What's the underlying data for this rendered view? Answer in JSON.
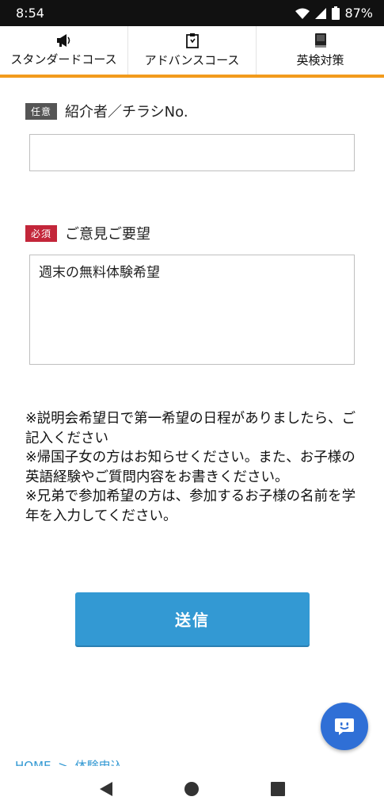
{
  "status_bar": {
    "time": "8:54",
    "battery": "87%"
  },
  "nav": {
    "items": [
      {
        "label": "スタンダードコース",
        "icon": "megaphone-icon"
      },
      {
        "label": "アドバンスコース",
        "icon": "clipboard-icon"
      },
      {
        "label": "英検対策",
        "icon": "book-icon"
      }
    ],
    "accent_color": "#f29b1c"
  },
  "form": {
    "referrer": {
      "badge": "任意",
      "label": "紹介者／チラシNo.",
      "value": ""
    },
    "comments": {
      "badge": "必須",
      "label": "ご意見ご要望",
      "value": "週末の無料体験希望"
    },
    "notes": [
      "※説明会希望日で第一希望の日程がありましたら、ご記入ください",
      "※帰国子女の方はお知らせください。また、お子様の英語経験やご質問内容をお書きください。",
      "※兄弟で参加希望の方は、参加するお子様の名前を学年を入力してください。"
    ],
    "submit_label": "送信"
  },
  "breadcrumb": {
    "home": "HOME",
    "separator": ">",
    "current": "体験申込"
  },
  "colors": {
    "button": "#3399d3",
    "required_badge": "#c3263a",
    "optional_badge": "#555555",
    "fab": "#2f6fd6"
  }
}
